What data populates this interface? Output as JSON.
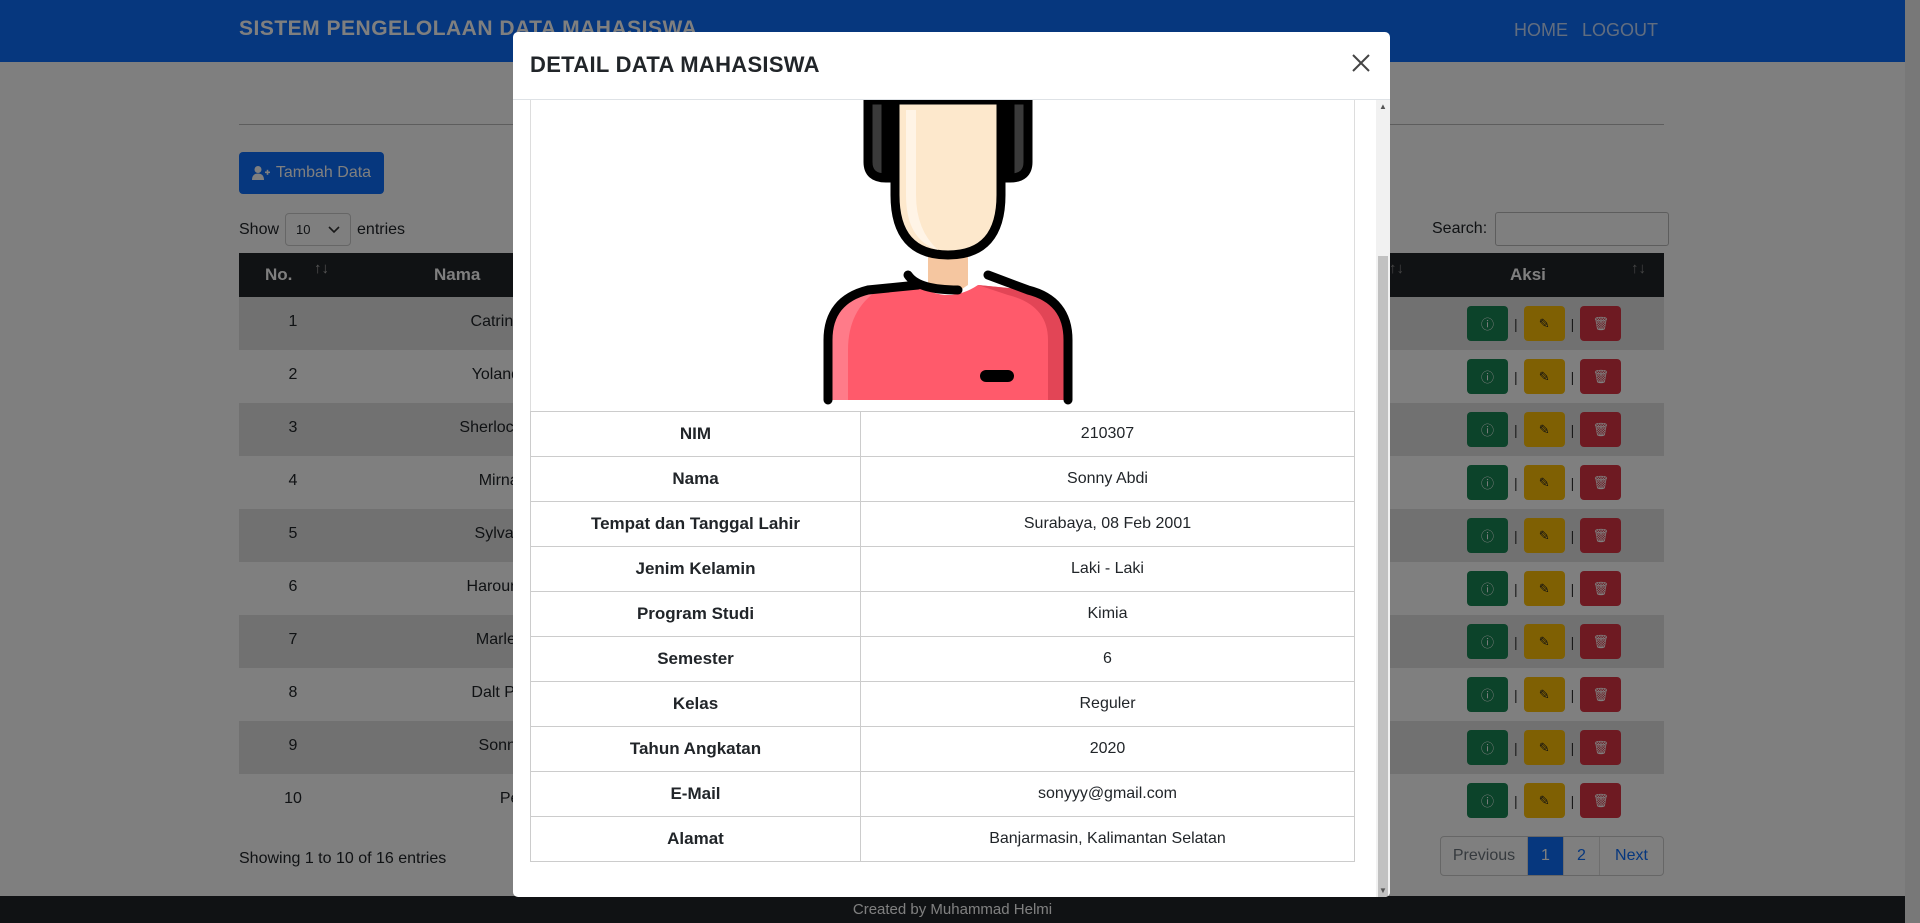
{
  "navbar": {
    "brand": "SISTEM PENGELOLAAN DATA MAHASISWA",
    "home": "HOME",
    "logout": "LOGOUT"
  },
  "toolbar": {
    "add_button": "Tambah Data",
    "show_label": "Show",
    "entries_value": "10",
    "entries_label": "entries",
    "search_label": "Search:"
  },
  "table": {
    "headers": {
      "no": "No.",
      "nama": "Nama",
      "aksi": "Aksi"
    },
    "rows": [
      {
        "no": "1",
        "nama": "Catrina De Br"
      },
      {
        "no": "2",
        "nama": "Yolande Arne"
      },
      {
        "no": "3",
        "nama": "Sherlock Frackie"
      },
      {
        "no": "4",
        "nama": "Mirna Duffil"
      },
      {
        "no": "5",
        "nama": "Sylvan Mizzi"
      },
      {
        "no": "6",
        "nama": "Haroun Mathia"
      },
      {
        "no": "7",
        "nama": "Marlee Ertel"
      },
      {
        "no": "8",
        "nama": "Dalt Polendin"
      },
      {
        "no": "9",
        "nama": "Sonny Abdi"
      },
      {
        "no": "10",
        "nama": "Petra"
      }
    ]
  },
  "pagination": {
    "info": "Showing 1 to 10 of 16 entries",
    "previous": "Previous",
    "page1": "1",
    "page2": "2",
    "next": "Next"
  },
  "footer": {
    "text": "Created by Muhammad Helmi"
  },
  "modal": {
    "title": "DETAIL DATA MAHASISWA",
    "details": [
      {
        "key": "NIM",
        "value": "210307"
      },
      {
        "key": "Nama",
        "value": "Sonny Abdi"
      },
      {
        "key": "Tempat dan Tanggal Lahir",
        "value": "Surabaya, 08 Feb 2001"
      },
      {
        "key": "Jenim Kelamin",
        "value": "Laki - Laki"
      },
      {
        "key": "Program Studi",
        "value": "Kimia"
      },
      {
        "key": "Semester",
        "value": "6"
      },
      {
        "key": "Kelas",
        "value": "Reguler"
      },
      {
        "key": "Tahun Angkatan",
        "value": "2020"
      },
      {
        "key": "E-Mail",
        "value": "sonyyy@gmail.com"
      },
      {
        "key": "Alamat",
        "value": "Banjarmasin, Kalimantan Selatan"
      }
    ]
  },
  "colors": {
    "primary": "#0d6efd",
    "dark": "#212529",
    "success": "#198754",
    "warning": "#ffc107",
    "danger": "#dc3545"
  }
}
